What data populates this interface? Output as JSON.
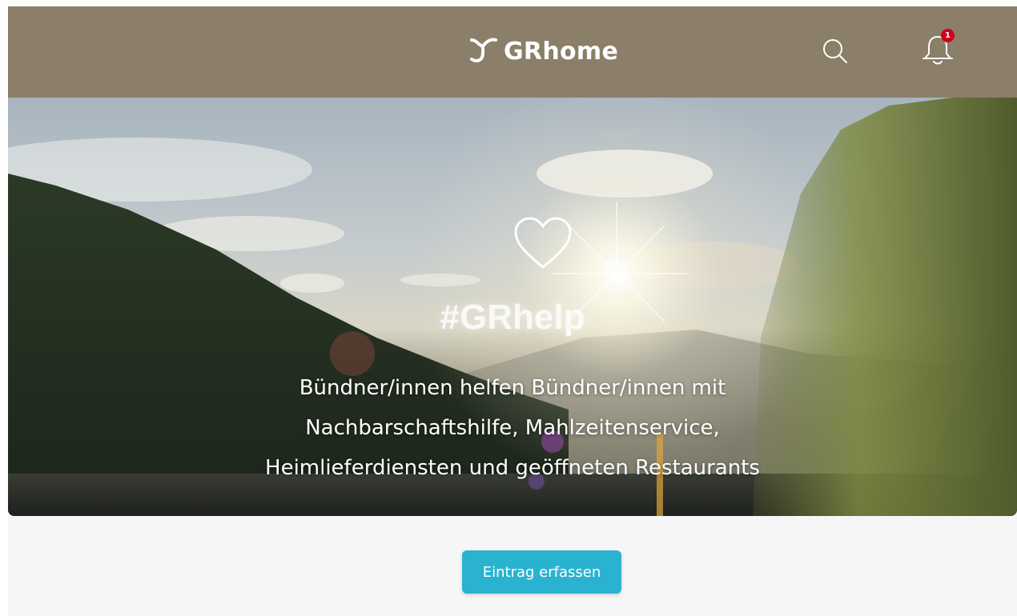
{
  "header": {
    "brand_name": "GRhome",
    "logo_icon": "grhome-logo-icon",
    "search_icon": "search-icon",
    "notification_icon": "bell-icon",
    "notification_count": "1",
    "bar_color": "#8b7f69",
    "badge_color": "#d0021b"
  },
  "hero": {
    "icon": "heart-icon",
    "hashtag": "#GRhelp",
    "description": "Bündner/innen helfen Bündner/innen mit Nachbarschaftshilfe, Mahlzeitenservice, Heimlieferdiensten und geöffneten Restaurants"
  },
  "cta": {
    "label": "Eintrag erfassen",
    "color": "#2ab3d0"
  }
}
